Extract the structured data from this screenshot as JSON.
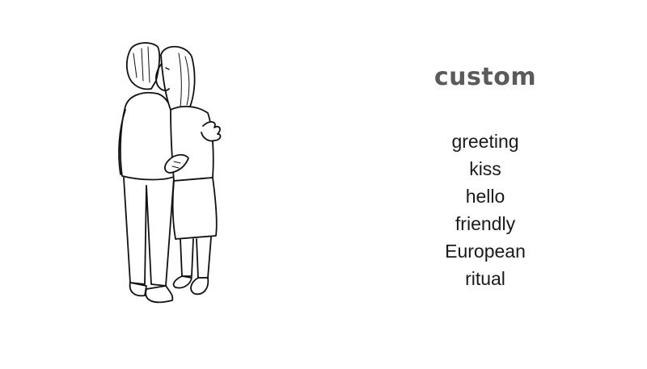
{
  "heading": "custom",
  "words": [
    "greeting",
    "kiss",
    "hello",
    "friendly",
    "European",
    "ritual"
  ]
}
